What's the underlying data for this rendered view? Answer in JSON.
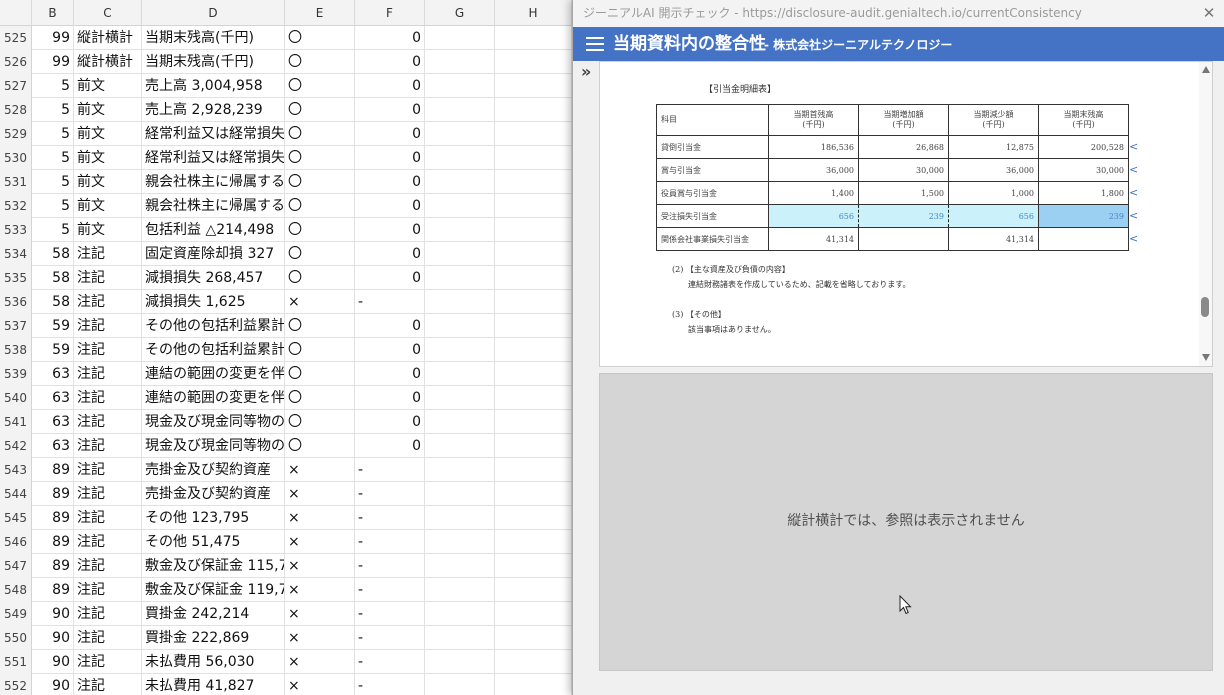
{
  "sheet": {
    "columns": [
      "B",
      "C",
      "D",
      "E",
      "F",
      "G",
      "H"
    ],
    "rows": [
      {
        "rn": "525",
        "b": "99",
        "c": "縦計横計",
        "d": "当期末残高(千円)",
        "e": "〇",
        "f": "0"
      },
      {
        "rn": "526",
        "b": "99",
        "c": "縦計横計",
        "d": "当期末残高(千円)",
        "e": "〇",
        "f": "0"
      },
      {
        "rn": "527",
        "b": "5",
        "c": "前文",
        "d": "売上高 3,004,958",
        "e": "〇",
        "f": "0"
      },
      {
        "rn": "528",
        "b": "5",
        "c": "前文",
        "d": "売上高 2,928,239",
        "e": "〇",
        "f": "0"
      },
      {
        "rn": "529",
        "b": "5",
        "c": "前文",
        "d": "経常利益又は経常損失",
        "e": "〇",
        "f": "0"
      },
      {
        "rn": "530",
        "b": "5",
        "c": "前文",
        "d": "経常利益又は経常損失",
        "e": "〇",
        "f": "0"
      },
      {
        "rn": "531",
        "b": "5",
        "c": "前文",
        "d": "親会社株主に帰属する",
        "e": "〇",
        "f": "0"
      },
      {
        "rn": "532",
        "b": "5",
        "c": "前文",
        "d": "親会社株主に帰属する",
        "e": "〇",
        "f": "0"
      },
      {
        "rn": "533",
        "b": "5",
        "c": "前文",
        "d": "包括利益 △214,498",
        "e": "〇",
        "f": "0"
      },
      {
        "rn": "534",
        "b": "58",
        "c": "注記",
        "d": "固定資産除却損 327",
        "e": "〇",
        "f": "0"
      },
      {
        "rn": "535",
        "b": "58",
        "c": "注記",
        "d": "減損損失 268,457",
        "e": "〇",
        "f": "0"
      },
      {
        "rn": "536",
        "b": "58",
        "c": "注記",
        "d": "減損損失 1,625",
        "e": "×",
        "f": "-"
      },
      {
        "rn": "537",
        "b": "59",
        "c": "注記",
        "d": "その他の包括利益累計",
        "e": "〇",
        "f": "0"
      },
      {
        "rn": "538",
        "b": "59",
        "c": "注記",
        "d": "その他の包括利益累計",
        "e": "〇",
        "f": "0"
      },
      {
        "rn": "539",
        "b": "63",
        "c": "注記",
        "d": "連結の範囲の変更を伴",
        "e": "〇",
        "f": "0"
      },
      {
        "rn": "540",
        "b": "63",
        "c": "注記",
        "d": "連結の範囲の変更を伴",
        "e": "〇",
        "f": "0"
      },
      {
        "rn": "541",
        "b": "63",
        "c": "注記",
        "d": "現金及び現金同等物の",
        "e": "〇",
        "f": "0"
      },
      {
        "rn": "542",
        "b": "63",
        "c": "注記",
        "d": "現金及び現金同等物の",
        "e": "〇",
        "f": "0"
      },
      {
        "rn": "543",
        "b": "89",
        "c": "注記",
        "d": "売掛金及び契約資産",
        "e": "×",
        "f": "-"
      },
      {
        "rn": "544",
        "b": "89",
        "c": "注記",
        "d": "売掛金及び契約資産",
        "e": "×",
        "f": "-"
      },
      {
        "rn": "545",
        "b": "89",
        "c": "注記",
        "d": "その他 123,795",
        "e": "×",
        "f": "-"
      },
      {
        "rn": "546",
        "b": "89",
        "c": "注記",
        "d": "その他 51,475",
        "e": "×",
        "f": "-"
      },
      {
        "rn": "547",
        "b": "89",
        "c": "注記",
        "d": "敷金及び保証金 115,7",
        "e": "×",
        "f": "-"
      },
      {
        "rn": "548",
        "b": "89",
        "c": "注記",
        "d": "敷金及び保証金 119,7",
        "e": "×",
        "f": "-"
      },
      {
        "rn": "549",
        "b": "90",
        "c": "注記",
        "d": "買掛金 242,214",
        "e": "×",
        "f": "-"
      },
      {
        "rn": "550",
        "b": "90",
        "c": "注記",
        "d": "買掛金 222,869",
        "e": "×",
        "f": "-"
      },
      {
        "rn": "551",
        "b": "90",
        "c": "注記",
        "d": "未払費用 56,030",
        "e": "×",
        "f": "-"
      },
      {
        "rn": "552",
        "b": "90",
        "c": "注記",
        "d": "未払費用 41,827",
        "e": "×",
        "f": "-"
      }
    ]
  },
  "popup": {
    "window_title": "ジーニアルAI 開示チェック - https://disclosure-audit.genialtech.io/currentConsistency",
    "close_symbol": "✕",
    "app_title": "当期資料内の整合性",
    "app_subtitle": "- 株式会社ジーニアルテクノロジー",
    "expand_symbol": "»",
    "doc": {
      "heading": "【引当金明細表】",
      "table_headers": [
        "科目",
        "当期首残高\n(千円)",
        "当期増加額\n(千円)",
        "当期減少額\n(千円)",
        "当期末残高\n(千円)"
      ],
      "table_rows": [
        {
          "name": "貸倒引当金",
          "v1": "186,536",
          "v2": "26,868",
          "v3": "12,875",
          "v4": "200,528",
          "mark": "<"
        },
        {
          "name": "賞与引当金",
          "v1": "36,000",
          "v2": "30,000",
          "v3": "36,000",
          "v4": "30,000",
          "mark": "<"
        },
        {
          "name": "役員賞与引当金",
          "v1": "1,400",
          "v2": "1,500",
          "v3": "1,000",
          "v4": "1,800",
          "mark": "<"
        },
        {
          "name": "受注損失引当金",
          "v1": "656",
          "v2": "239",
          "v3": "656",
          "v4": "239",
          "mark": "<"
        },
        {
          "name": "関係会社事業損失引当金",
          "v1": "41,314",
          "v2": "",
          "v3": "41,314",
          "v4": "",
          "mark": "<"
        }
      ],
      "note2_title": "(2) 【主な資産及び負債の内容】",
      "note2_body": "連結財務諸表を作成しているため、記載を省略しております。",
      "note3_title": "(3) 【その他】",
      "note3_body": "該当事項はありません。"
    },
    "ref_message": "縦計横計では、参照は表示されません"
  }
}
